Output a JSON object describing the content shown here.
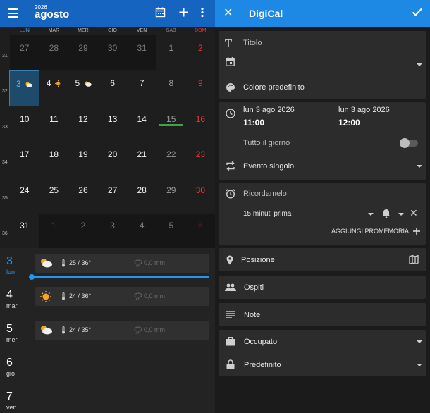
{
  "calendar": {
    "year": "2026",
    "month": "agosto",
    "weekdays": [
      "LUN",
      "MAR",
      "MER",
      "GIO",
      "VEN",
      "SAB",
      "DOM"
    ],
    "weeks": [
      {
        "num": "31",
        "days": [
          "27",
          "28",
          "29",
          "30",
          "31",
          "1",
          "2"
        ]
      },
      {
        "num": "32",
        "days": [
          "3",
          "4",
          "5",
          "6",
          "7",
          "8",
          "9"
        ]
      },
      {
        "num": "33",
        "days": [
          "10",
          "11",
          "12",
          "13",
          "14",
          "15",
          "16"
        ]
      },
      {
        "num": "34",
        "days": [
          "17",
          "18",
          "19",
          "20",
          "21",
          "22",
          "23"
        ]
      },
      {
        "num": "35",
        "days": [
          "24",
          "25",
          "26",
          "27",
          "28",
          "29",
          "30"
        ]
      },
      {
        "num": "36",
        "days": [
          "31",
          "1",
          "2",
          "3",
          "4",
          "5",
          "6"
        ]
      }
    ]
  },
  "agenda": [
    {
      "num": "3",
      "name": "lun",
      "temp": "25 / 36°",
      "rain": "0,0 mm",
      "icon": "partly-cloudy-icon"
    },
    {
      "num": "4",
      "name": "mar",
      "temp": "24 / 36°",
      "rain": "0,0 mm",
      "icon": "sun-icon"
    },
    {
      "num": "5",
      "name": "mer",
      "temp": "24 / 35°",
      "rain": "0,0 mm",
      "icon": "partly-cloudy-icon"
    },
    {
      "num": "6",
      "name": "gio"
    },
    {
      "num": "7",
      "name": "ven"
    }
  ],
  "editor": {
    "app_name": "DigiCal",
    "title_placeholder": "Titolo",
    "color": "Colore predefinito",
    "start_date": "lun 3 ago 2026",
    "start_time": "11:00",
    "end_date": "lun 3 ago 2026",
    "end_time": "12:00",
    "all_day": "Tutto il giorno",
    "all_day_on": false,
    "repeat": "Evento singolo",
    "reminder_title": "Ricordamelo",
    "reminder_value": "15 minuti prima",
    "add_reminder": "AGGIUNGI PROMEMORIA",
    "location": "Posizione",
    "guests": "Ospiti",
    "notes": "Note",
    "availability": "Occupato",
    "privacy": "Predefinito"
  },
  "colors": {
    "left_appbar": "#1565c0",
    "right_appbar": "#1e88e5",
    "accent": "#2196f3",
    "sunday": "#e53935",
    "holiday_bar": "#43a047"
  }
}
